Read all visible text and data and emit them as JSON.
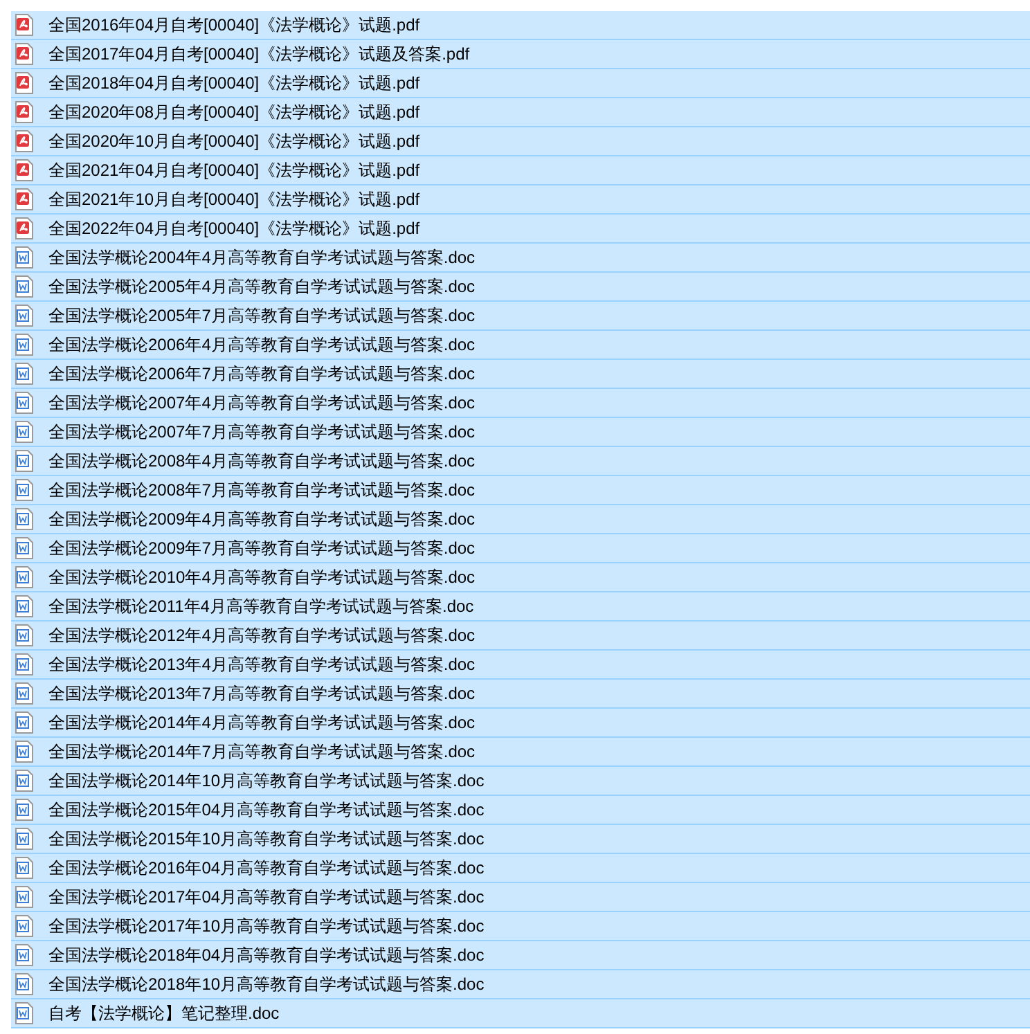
{
  "files": [
    {
      "kind": "pdf",
      "name": "全国2016年04月自考[00040]《法学概论》试题.pdf",
      "selected": true
    },
    {
      "kind": "pdf",
      "name": "全国2017年04月自考[00040]《法学概论》试题及答案.pdf",
      "selected": true
    },
    {
      "kind": "pdf",
      "name": "全国2018年04月自考[00040]《法学概论》试题.pdf",
      "selected": true
    },
    {
      "kind": "pdf",
      "name": "全国2020年08月自考[00040]《法学概论》试题.pdf",
      "selected": true
    },
    {
      "kind": "pdf",
      "name": "全国2020年10月自考[00040]《法学概论》试题.pdf",
      "selected": true
    },
    {
      "kind": "pdf",
      "name": "全国2021年04月自考[00040]《法学概论》试题.pdf",
      "selected": true
    },
    {
      "kind": "pdf",
      "name": "全国2021年10月自考[00040]《法学概论》试题.pdf",
      "selected": true
    },
    {
      "kind": "pdf",
      "name": "全国2022年04月自考[00040]《法学概论》试题.pdf",
      "selected": true
    },
    {
      "kind": "doc",
      "name": "全国法学概论2004年4月高等教育自学考试试题与答案.doc",
      "selected": true
    },
    {
      "kind": "doc",
      "name": "全国法学概论2005年4月高等教育自学考试试题与答案.doc",
      "selected": true
    },
    {
      "kind": "doc",
      "name": "全国法学概论2005年7月高等教育自学考试试题与答案.doc",
      "selected": true
    },
    {
      "kind": "doc",
      "name": "全国法学概论2006年4月高等教育自学考试试题与答案.doc",
      "selected": true
    },
    {
      "kind": "doc",
      "name": "全国法学概论2006年7月高等教育自学考试试题与答案.doc",
      "selected": true
    },
    {
      "kind": "doc",
      "name": "全国法学概论2007年4月高等教育自学考试试题与答案.doc",
      "selected": true
    },
    {
      "kind": "doc",
      "name": "全国法学概论2007年7月高等教育自学考试试题与答案.doc",
      "selected": true
    },
    {
      "kind": "doc",
      "name": "全国法学概论2008年4月高等教育自学考试试题与答案.doc",
      "selected": true
    },
    {
      "kind": "doc",
      "name": "全国法学概论2008年7月高等教育自学考试试题与答案.doc",
      "selected": true
    },
    {
      "kind": "doc",
      "name": "全国法学概论2009年4月高等教育自学考试试题与答案.doc",
      "selected": true
    },
    {
      "kind": "doc",
      "name": "全国法学概论2009年7月高等教育自学考试试题与答案.doc",
      "selected": true
    },
    {
      "kind": "doc",
      "name": "全国法学概论2010年4月高等教育自学考试试题与答案.doc",
      "selected": true
    },
    {
      "kind": "doc",
      "name": "全国法学概论2011年4月高等教育自学考试试题与答案.doc",
      "selected": true
    },
    {
      "kind": "doc",
      "name": "全国法学概论2012年4月高等教育自学考试试题与答案.doc",
      "selected": true
    },
    {
      "kind": "doc",
      "name": "全国法学概论2013年4月高等教育自学考试试题与答案.doc",
      "selected": true
    },
    {
      "kind": "doc",
      "name": "全国法学概论2013年7月高等教育自学考试试题与答案.doc",
      "selected": true
    },
    {
      "kind": "doc",
      "name": "全国法学概论2014年4月高等教育自学考试试题与答案.doc",
      "selected": true
    },
    {
      "kind": "doc",
      "name": "全国法学概论2014年7月高等教育自学考试试题与答案.doc",
      "selected": true
    },
    {
      "kind": "doc",
      "name": "全国法学概论2014年10月高等教育自学考试试题与答案.doc",
      "selected": true
    },
    {
      "kind": "doc",
      "name": "全国法学概论2015年04月高等教育自学考试试题与答案.doc",
      "selected": true
    },
    {
      "kind": "doc",
      "name": "全国法学概论2015年10月高等教育自学考试试题与答案.doc",
      "selected": true
    },
    {
      "kind": "doc",
      "name": "全国法学概论2016年04月高等教育自学考试试题与答案.doc",
      "selected": true
    },
    {
      "kind": "doc",
      "name": "全国法学概论2017年04月高等教育自学考试试题与答案.doc",
      "selected": true
    },
    {
      "kind": "doc",
      "name": "全国法学概论2017年10月高等教育自学考试试题与答案.doc",
      "selected": true
    },
    {
      "kind": "doc",
      "name": "全国法学概论2018年04月高等教育自学考试试题与答案.doc",
      "selected": true
    },
    {
      "kind": "doc",
      "name": "全国法学概论2018年10月高等教育自学考试试题与答案.doc",
      "selected": true
    },
    {
      "kind": "doc",
      "name": "自考【法学概论】笔记整理.doc",
      "selected": true
    }
  ]
}
